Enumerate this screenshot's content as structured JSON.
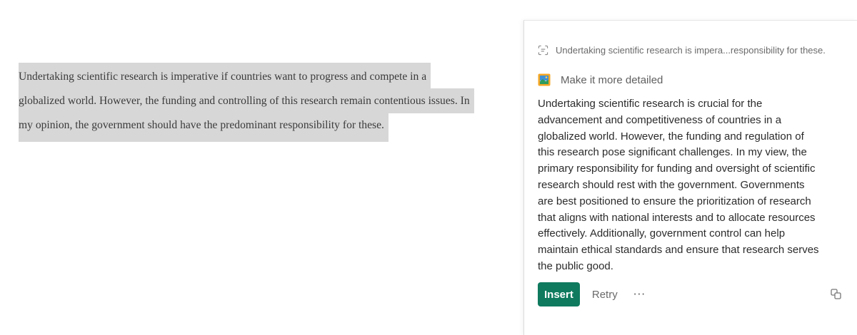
{
  "editor": {
    "lines": [
      "Undertaking scientific research is imperative if countries want to progress and compete in a",
      "globalized world. However, the funding and controlling of this research remain contentious issues. In",
      "my opinion, the government should have the predominant responsibility for these."
    ]
  },
  "assistant": {
    "source_excerpt": "Undertaking scientific research is impera...responsibility for these.",
    "prompt_label": "Make it more detailed",
    "result_lines": [
      "Undertaking scientific research is crucial for the",
      "advancement and competitiveness of countries in a",
      "globalized world. However, the funding and regulation of",
      "this research pose significant challenges. In my view, the",
      "primary responsibility for funding and oversight of scientific",
      "research should rest with the government. Governments",
      "are best positioned to ensure the prioritization of research",
      "that aligns with national interests and to allocate resources",
      "effectively. Additionally, government control can help",
      "maintain ethical standards and ensure that research serves",
      "the public good."
    ],
    "actions": {
      "insert_label": "Insert",
      "retry_label": "Retry",
      "more_label": "···"
    },
    "colors": {
      "accent": "#0f7a5e",
      "highlight": "#d7d7d7"
    },
    "icons": {
      "source": "text-scan-icon",
      "prompt": "image-prompt-icon",
      "copy": "copy-icon",
      "more": "more-dots-icon"
    }
  }
}
